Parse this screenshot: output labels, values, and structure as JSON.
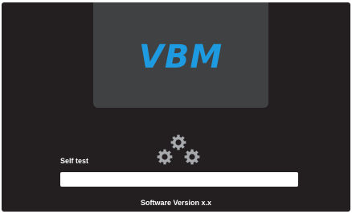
{
  "brand": {
    "logo_text": "VBM",
    "logo_color": "#1e9be0"
  },
  "status": {
    "label": "Self test",
    "progress_fraction": 0,
    "progress_fill_color": "#1e9be0",
    "busy_icon": "gears-icon"
  },
  "footer": {
    "version_text": "Software Version x.x"
  },
  "colors": {
    "screen_background": "#231f20",
    "logo_panel": "#404142",
    "gear": "#a7a9ac"
  }
}
